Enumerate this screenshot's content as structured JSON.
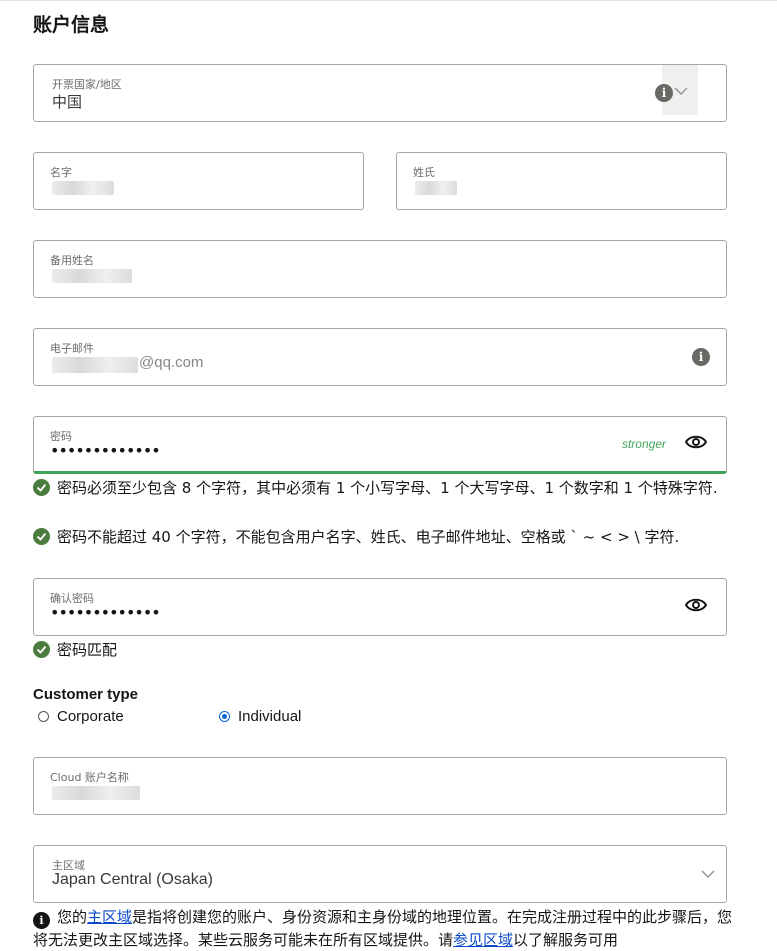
{
  "section_title": "账户信息",
  "billing_country": {
    "label": "开票国家/地区",
    "value": "中国"
  },
  "first_name": {
    "label": "名字"
  },
  "last_name": {
    "label": "姓氏"
  },
  "alt_name": {
    "label": "备用姓名"
  },
  "email": {
    "label": "电子邮件",
    "value_suffix": "@qq.com"
  },
  "password": {
    "label": "密码",
    "masked": "•••••••••••••",
    "strength": "stronger"
  },
  "password_rules": [
    {
      "text": "密码必须至少包含 8 个字符，其中必须有 1 个小写字母、1 个大写字母、1 个数字和 1 个特殊字符."
    },
    {
      "text": "密码不能超过 40 个字符，不能包含用户名字、姓氏、电子邮件地址、空格或 ` ~ < > \\ 字符."
    }
  ],
  "confirm_password": {
    "label": "确认密码",
    "masked": "•••••••••••••",
    "match_text": "密码匹配"
  },
  "customer_type": {
    "title": "Customer type",
    "options": [
      {
        "label": "Corporate",
        "selected": false
      },
      {
        "label": "Individual",
        "selected": true
      }
    ]
  },
  "cloud_account": {
    "label": "Cloud 账户名称"
  },
  "home_region": {
    "label": "主区域",
    "value": "Japan Central (Osaka)"
  },
  "region_note": {
    "prefix": "您的",
    "link1": "主区域",
    "middle": "是指将创建您的账户、身份资源和主身份域的地理位置。在完成注册过程中的此步骤后，您将无法更改主区域选择。某些云服务可能未在所有区域提供。请",
    "link2": "参见区域",
    "suffix": "以了解服务可用"
  },
  "colors": {
    "accent_green": "#3fa45b",
    "check_green": "#4a7c3d",
    "radio_blue": "#0a62d9",
    "link_blue": "#0b4ac9"
  }
}
